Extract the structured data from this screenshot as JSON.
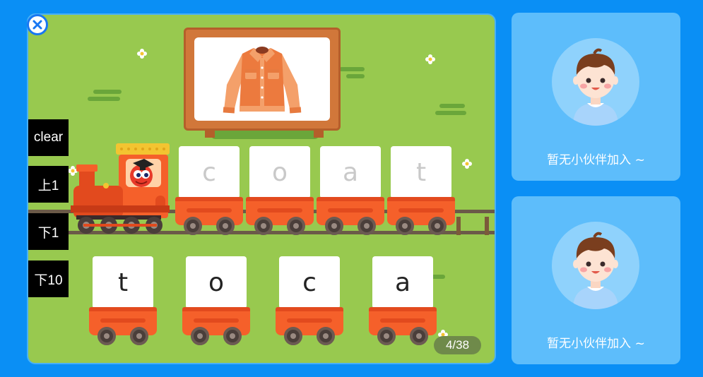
{
  "game": {
    "target_word_cards": [
      "c",
      "o",
      "a",
      "t"
    ],
    "choice_cards": [
      "t",
      "o",
      "c",
      "a"
    ],
    "picture": "jacket-icon",
    "progress": "4/38"
  },
  "debug_buttons": {
    "clear": "clear",
    "prev1": "上1",
    "next1": "下1",
    "next10": "下10"
  },
  "partners": [
    {
      "label": "暂无小伙伴加入 ~",
      "avatar": "boy-avatar-icon"
    },
    {
      "label": "暂无小伙伴加入 ~",
      "avatar": "boy-avatar-icon"
    }
  ],
  "colors": {
    "background": "#0a8ff5",
    "stage_grass": "#98c94f",
    "cart_orange": "#f5602a",
    "panel_blue": "#5dbdfb"
  }
}
